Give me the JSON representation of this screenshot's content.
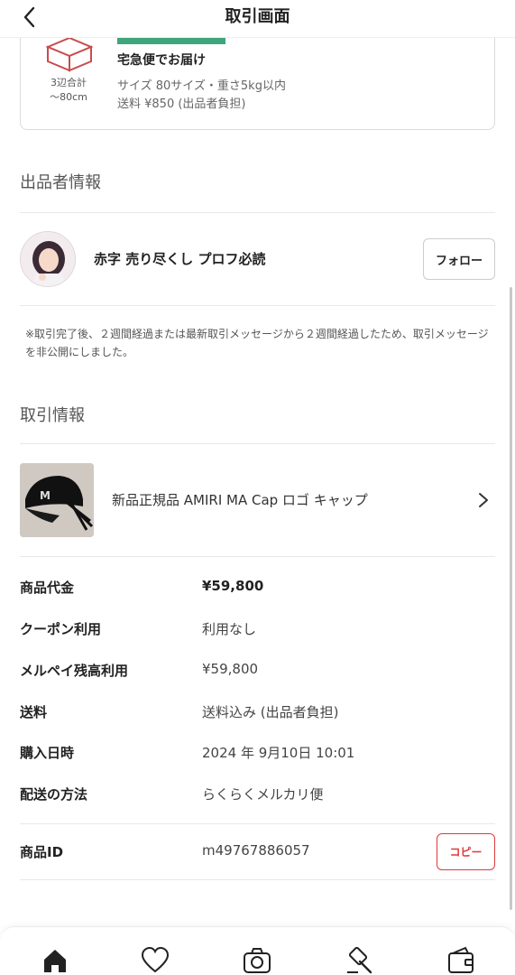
{
  "header": {
    "title": "取引画面"
  },
  "shipping": {
    "dimension_label": "3辺合計\n〜80cm",
    "name": "宅急便でお届け",
    "size": "サイズ  80サイズ・重さ5kg以内",
    "fee": "送料  ¥850 (出品者負担)",
    "accent_color": "#3ea57d"
  },
  "seller_section": {
    "title": "出品者情報",
    "name": "赤字 売り尽くし プロフ必読",
    "follow_label": "フォロー"
  },
  "notice": "※取引完了後、２週間経過または最新取引メッセージから２週間経過したため、取引メッセージを非公開にしました。",
  "transaction_section": {
    "title": "取引情報",
    "product_name": "新品正規品 AMIRI MA Cap ロゴ キャップ",
    "rows": [
      {
        "label": "商品代金",
        "value": "¥59,800"
      },
      {
        "label": "クーポン利用",
        "value": "利用なし"
      },
      {
        "label": "メルペイ残高利用",
        "value": "¥59,800"
      },
      {
        "label": "送料",
        "value": "送料込み (出品者負担)"
      },
      {
        "label": "購入日時",
        "value": "2024 年 9月10日 10:01"
      },
      {
        "label": "配送の方法",
        "value": "らくらくメルカリ便"
      }
    ],
    "product_id_label": "商品ID",
    "product_id": "m49767886057",
    "copy_label": "コピー",
    "copy_color": "#e03a3a"
  },
  "tabbar": {
    "icons": [
      "home-icon",
      "heart-icon",
      "camera-icon",
      "auction-hammer-icon",
      "wallet-icon"
    ]
  }
}
